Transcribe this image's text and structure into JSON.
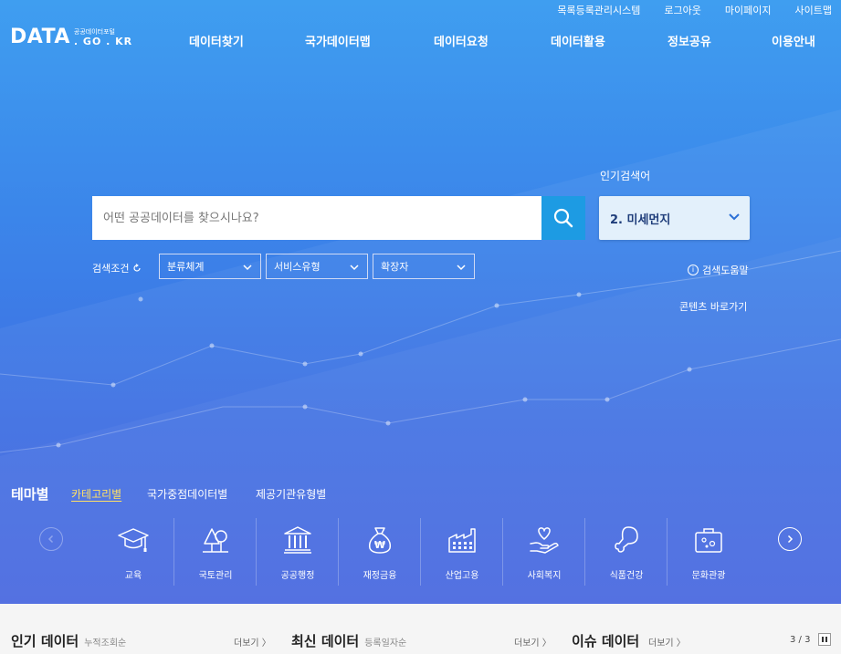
{
  "util_links": [
    "목록등록관리시스템",
    "로그아웃",
    "마이페이지",
    "사이트맵"
  ],
  "logo": {
    "main": "DATA",
    "sub1": "공공데이터포털",
    "sub2": ". GO . KR"
  },
  "nav": [
    "데이터찾기",
    "국가데이터맵",
    "데이터요청",
    "데이터활용",
    "정보공유",
    "이용안내"
  ],
  "search": {
    "placeholder": "어떤 공공데이터를 찾으시나요?",
    "popular_label": "인기검색어",
    "popular_keyword": "2. 미세먼지",
    "condition_label": "검색조건",
    "selects": [
      "분류체계",
      "서비스유형",
      "확장자"
    ],
    "help": "검색도움말",
    "shortcut": "콘텐츠 바로가기"
  },
  "theme": {
    "title": "테마별",
    "tabs": [
      "카테고리별",
      "국가중점데이터별",
      "제공기관유형별"
    ],
    "categories": [
      "교육",
      "국토관리",
      "공공행정",
      "재정금융",
      "산업고용",
      "사회복지",
      "식품건강",
      "문화관광"
    ]
  },
  "bottom": {
    "popular": {
      "title": "인기 데이터",
      "sub": "누적조회순",
      "more": "더보기 〉"
    },
    "latest": {
      "title": "최신 데이터",
      "sub": "등록일자순",
      "more": "더보기 〉"
    },
    "issue": {
      "title": "이슈 데이터",
      "more": "더보기 〉"
    },
    "pager": "3 / 3"
  },
  "colors": {
    "search_button": "#1d9be3",
    "active_tab": "#ffe066",
    "popular_box": "#e3f0fb"
  }
}
